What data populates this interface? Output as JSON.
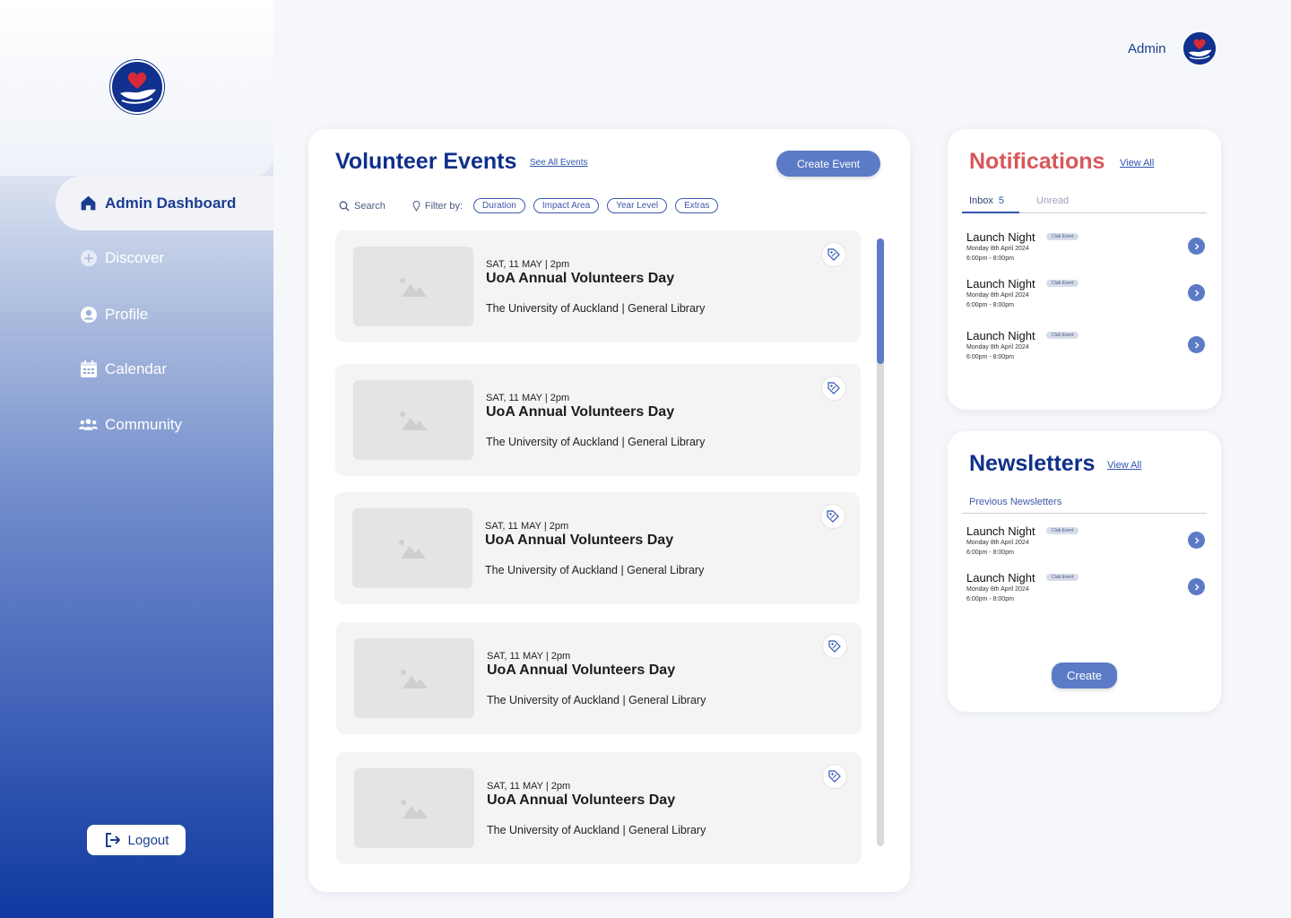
{
  "sidebar": {
    "logo_icon": "heart-in-hand-logo",
    "active": {
      "label": "Admin Dashboard",
      "icon": "home-icon"
    },
    "items": [
      {
        "label": "Discover",
        "icon": "plus-circle-icon"
      },
      {
        "label": "Profile",
        "icon": "user-circle-icon"
      },
      {
        "label": "Calendar",
        "icon": "calendar-icon"
      },
      {
        "label": "Community",
        "icon": "community-icon"
      }
    ],
    "logout_label": "Logout"
  },
  "header": {
    "user_label": "Admin"
  },
  "events": {
    "title": "Volunteer Events",
    "see_all": "See All Events",
    "create_label": "Create Event",
    "search_label": "Search",
    "filter_label": "Filter by:",
    "filters": [
      "Duration",
      "Impact Area",
      "Year Level",
      "Extras"
    ],
    "items": [
      {
        "date": "SAT, 11 MAY | 2pm",
        "title": "UoA Annual Volunteers Day",
        "place": "The University of Auckland | General Library"
      },
      {
        "date": "SAT, 11 MAY | 2pm",
        "title": "UoA Annual Volunteers Day",
        "place": "The University of Auckland | General Library"
      },
      {
        "date": "SAT, 11 MAY | 2pm",
        "title": "UoA Annual Volunteers Day",
        "place": "The University of Auckland | General Library"
      },
      {
        "date": "SAT, 11 MAY | 2pm",
        "title": "UoA Annual Volunteers Day",
        "place": "The University of Auckland | General Library"
      },
      {
        "date": "SAT, 11 MAY | 2pm",
        "title": "UoA Annual Volunteers Day",
        "place": "The University of Auckland | General Library"
      }
    ]
  },
  "notifications": {
    "title": "Notifications",
    "view_all": "View All",
    "tabs": {
      "inbox": "Inbox",
      "inbox_count": "5",
      "unread": "Unread"
    },
    "items": [
      {
        "title": "Launch Night",
        "badge": "Club Event",
        "date": "Monday 8th April 2024",
        "time": "6:00pm - 8:00pm"
      },
      {
        "title": "Launch Night",
        "badge": "Club Event",
        "date": "Monday 8th April 2024",
        "time": "6:00pm - 8:00pm"
      },
      {
        "title": "Launch Night",
        "badge": "Club Event",
        "date": "Monday 8th April 2024",
        "time": "6:00pm - 8:00pm"
      }
    ]
  },
  "newsletters": {
    "title": "Newsletters",
    "view_all": "View All",
    "section_label": "Previous Newsletters",
    "items": [
      {
        "title": "Launch Night",
        "badge": "Club Event",
        "date": "Monday 8th April 2024",
        "time": "6:00pm - 8:00pm"
      },
      {
        "title": "Launch Night",
        "badge": "Club Event",
        "date": "Monday 8th April 2024",
        "time": "6:00pm - 8:00pm"
      }
    ],
    "create_label": "Create"
  },
  "colors": {
    "brand_navy": "#0f2f8a",
    "accent_blue": "#5c7bc6",
    "notification_red": "#d9575a",
    "heart_red": "#d62a3a"
  }
}
